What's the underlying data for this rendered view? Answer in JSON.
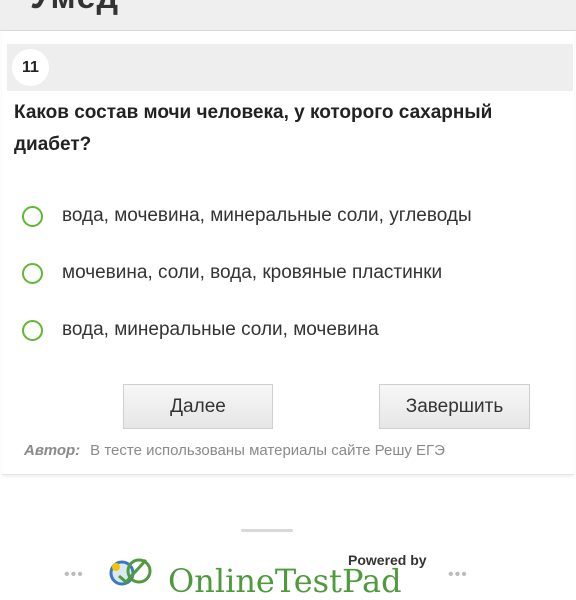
{
  "header": {
    "title": "Умед"
  },
  "question": {
    "number": "11",
    "text": "Каков состав мочи человека, у которого сахарный диабет?",
    "options": [
      "вода, мочевина, минеральные соли, углеводы",
      "мочевина, соли, вода, кровяные пластинки",
      "вода, минеральные соли, мочевина"
    ]
  },
  "buttons": {
    "next": "Далее",
    "finish": "Завершить"
  },
  "author": {
    "label": "Автор:",
    "text": "В тесте использованы материалы сайте Решу ЕГЭ"
  },
  "footer": {
    "powered_by": "Powered by",
    "brand": "OnlineTestPad",
    "logo_icon": "online-test-pad-logo-icon",
    "dots": "•••"
  },
  "colors": {
    "radio_border": "#5fb832",
    "brand_green": "#4f9a3c",
    "number_strip": "#eeeeee"
  }
}
